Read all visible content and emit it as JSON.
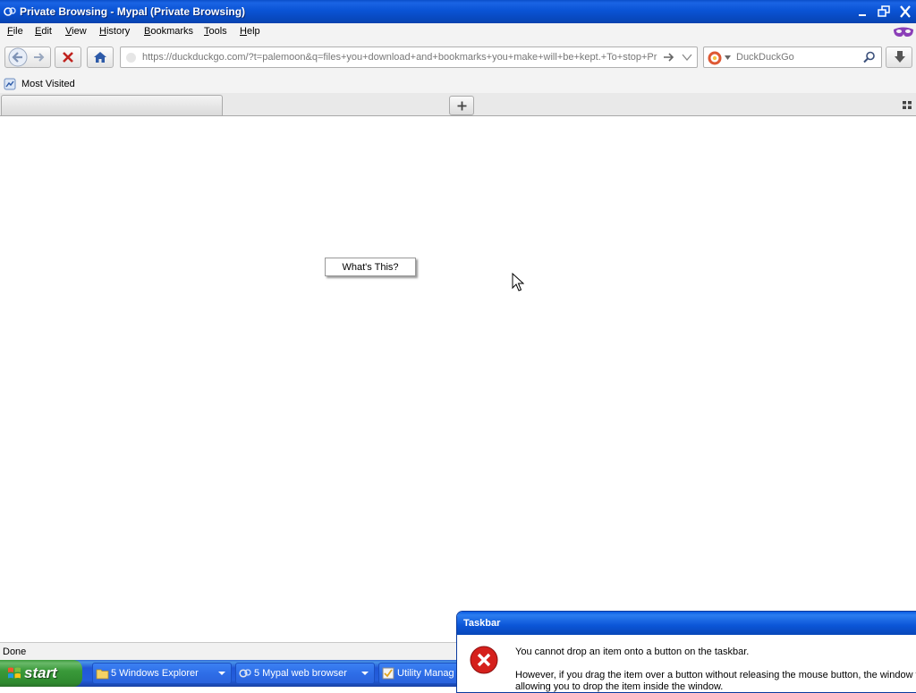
{
  "window": {
    "title": "Private Browsing - Mypal (Private Browsing)",
    "title_icon": "browser-logo-icon",
    "controls": [
      "minimize-icon",
      "restore-icon",
      "close-icon"
    ]
  },
  "menu": {
    "items": [
      "File",
      "Edit",
      "View",
      "History",
      "Bookmarks",
      "Tools",
      "Help"
    ],
    "private_icon": "private-mask-icon"
  },
  "nav": {
    "url": "https://duckduckgo.com/?t=palemoon&q=files+you+download+and+bookmarks+you+make+will+be+kept.+To+stop+Priva",
    "search_engine": "DuckDuckGo",
    "search_placeholder": "DuckDuckGo",
    "icons": [
      "back-icon",
      "forward-icon",
      "stop-icon",
      "home-icon",
      "go-arrow-icon",
      "dropdown-icon",
      "search-icon",
      "download-icon"
    ]
  },
  "bookmarks": {
    "most_visited": "Most Visited"
  },
  "tabs": {
    "new_tab_label": "+",
    "current_tab_label": ""
  },
  "content": {
    "popup_label": "What's This?"
  },
  "status": {
    "text": "Done"
  },
  "taskbar": {
    "start_label": "start",
    "buttons": [
      {
        "label": "5 Windows Explorer"
      },
      {
        "label": "5 Mypal web browser"
      },
      {
        "label": "Utility Manag"
      }
    ]
  },
  "balloon": {
    "title": "Taskbar",
    "message_line1": "You cannot drop an item onto a button on the taskbar.",
    "message_line2": "However, if you drag the item over a button without releasing the mouse button, the window will",
    "message_line3": "allowing you to drop the item inside the window."
  },
  "colors": {
    "titlebar": "#0a53d5",
    "taskbar": "#245edb",
    "start_green": "#3a9a3a",
    "error_red": "#d5201c"
  }
}
